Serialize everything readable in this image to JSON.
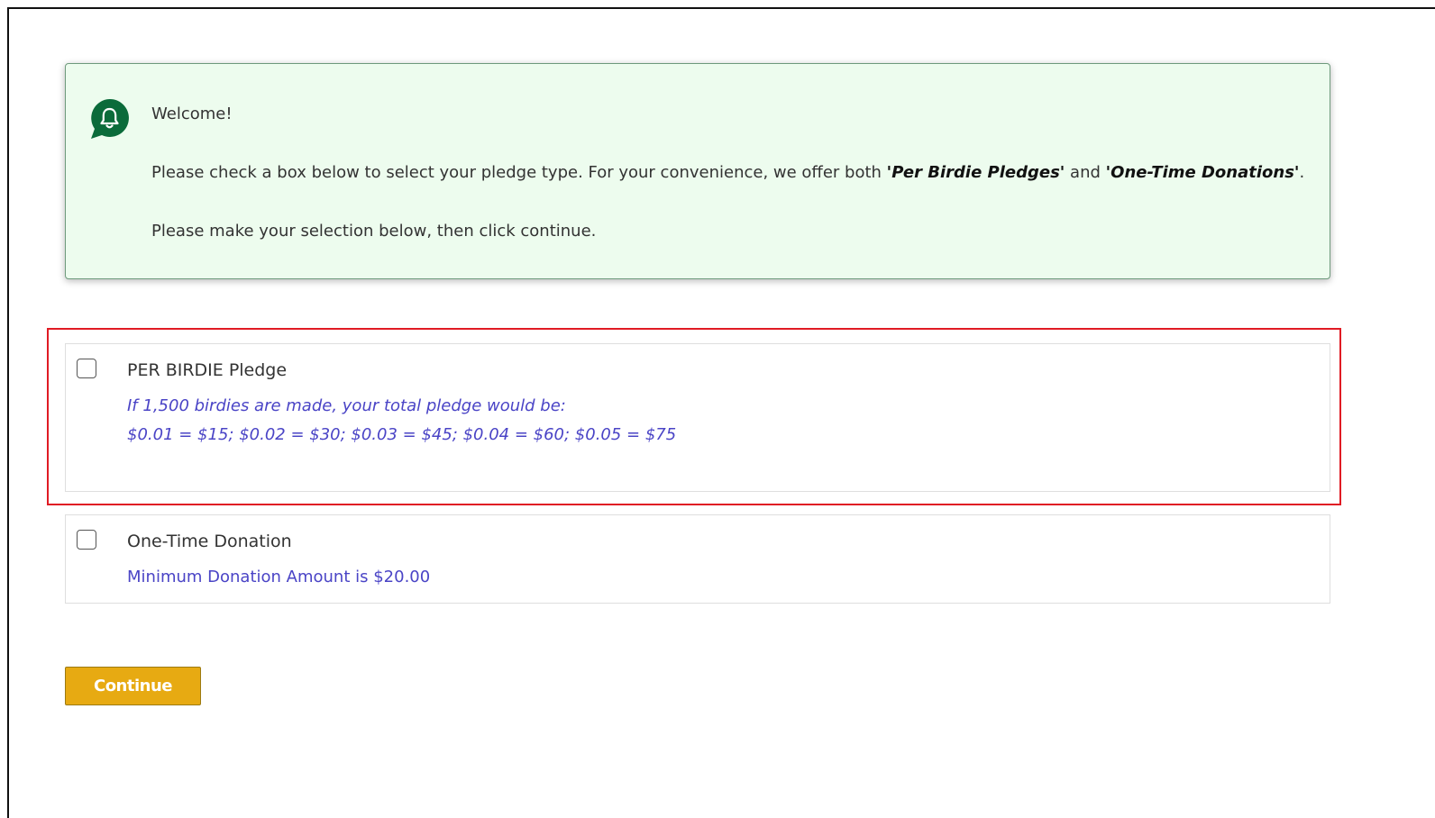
{
  "welcome": {
    "icon": "bell-chat-icon",
    "icon_color": "#0b6b3a",
    "greeting": "Welcome!",
    "instruction_prefix": "Please check a box below to select your pledge type. For your convenience, we offer both ",
    "quote_open_1": "'",
    "option_1_name": "Per Birdie Pledges'",
    "and_text": " and ",
    "quote_open_2": "'",
    "option_2_name": "One-Time Donations'",
    "instruction_suffix": ".",
    "selection_hint": "Please make your selection below, then click continue."
  },
  "options": [
    {
      "title": "PER BIRDIE Pledge",
      "checked": false,
      "line1": "If 1,500 birdies are made, your total pledge would be:",
      "line2": "$0.01 = $15; $0.02 = $30; $0.03 = $45; $0.04 = $60; $0.05 = $75"
    },
    {
      "title": "One-Time Donation",
      "checked": false,
      "line1": "Minimum Donation Amount is $20.00"
    }
  ],
  "continue_label": "Continue",
  "colors": {
    "welcome_bg": "#edfcee",
    "highlight_border": "#e01b24",
    "option_text": "#4a44c6",
    "button_bg": "#e7aa12"
  }
}
